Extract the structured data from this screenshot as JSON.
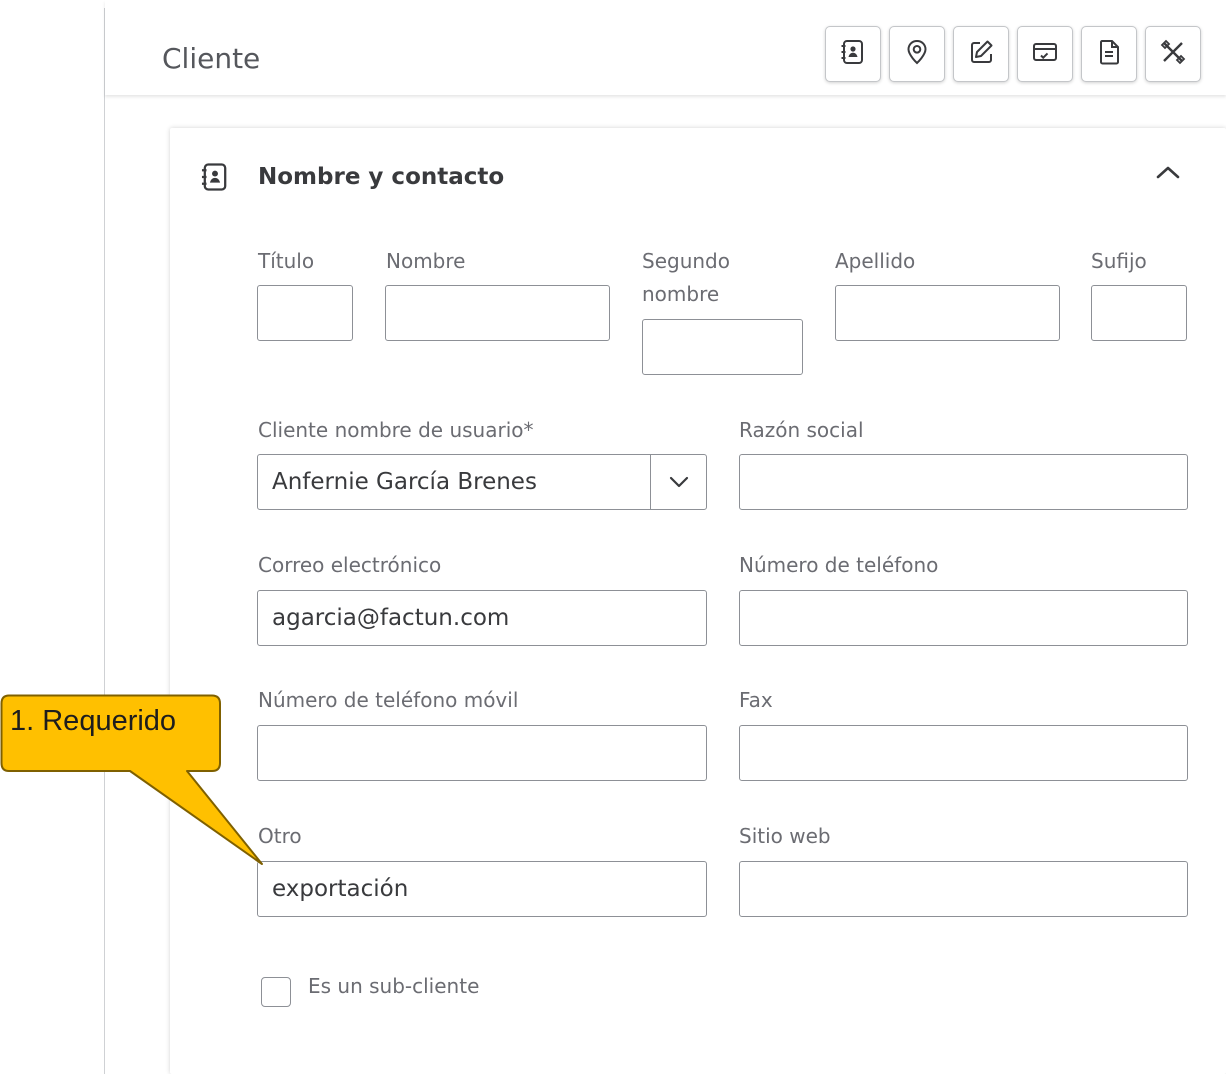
{
  "header": {
    "title": "Cliente",
    "toolbar_icons": [
      "contact-book-icon",
      "location-pin-icon",
      "edit-note-icon",
      "payments-icon",
      "document-icon",
      "tools-icon"
    ]
  },
  "section": {
    "title": "Nombre y contacto",
    "icon": "contact-book-icon"
  },
  "fields": {
    "titulo": {
      "label": "Título",
      "value": ""
    },
    "nombre": {
      "label": "Nombre",
      "value": ""
    },
    "segundo_nombre": {
      "label_line1": "Segundo",
      "label_line2": "nombre",
      "value": ""
    },
    "apellido": {
      "label": "Apellido",
      "value": ""
    },
    "sufijo": {
      "label": "Sufijo",
      "value": ""
    },
    "display_name": {
      "label": "Cliente nombre de usuario*",
      "value": "Anfernie García Brenes"
    },
    "razon_social": {
      "label": "Razón social",
      "value": ""
    },
    "correo": {
      "label": "Correo electrónico",
      "value": "agarcia@factun.com"
    },
    "telefono": {
      "label": "Número de teléfono",
      "value": ""
    },
    "movil": {
      "label": "Número de teléfono móvil",
      "value": ""
    },
    "fax": {
      "label": "Fax",
      "value": ""
    },
    "otro": {
      "label": "Otro",
      "value": "exportación"
    },
    "sitio_web": {
      "label": "Sitio web",
      "value": ""
    }
  },
  "subcliente": {
    "label": "Es un sub-cliente",
    "checked": false
  },
  "callout": {
    "text": "1. Requerido",
    "color": "#ffc000"
  },
  "colors": {
    "border": "#8d9096",
    "text": "#393a3d",
    "label": "#6b6c72"
  }
}
